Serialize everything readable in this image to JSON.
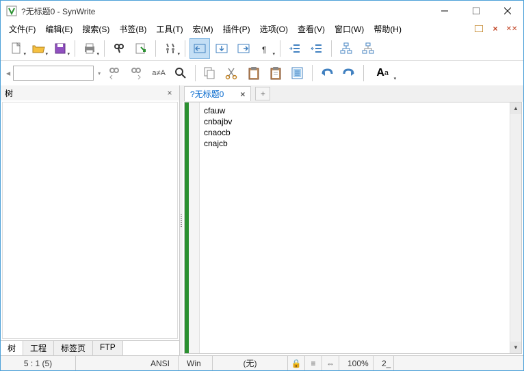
{
  "window": {
    "title": "?无标题0 - SynWrite"
  },
  "menu": {
    "items": [
      "文件(F)",
      "编辑(E)",
      "搜索(S)",
      "书签(B)",
      "工具(T)",
      "宏(M)",
      "插件(P)",
      "选项(O)",
      "查看(V)",
      "窗口(W)",
      "帮助(H)"
    ]
  },
  "left": {
    "title": "树",
    "tabs": [
      "树",
      "工程",
      "标签页",
      "FTP"
    ]
  },
  "doc": {
    "tab_label": "?无标题0",
    "lines": [
      "cfauw",
      "cnbajbv",
      "cnaocb",
      "cnajcb"
    ]
  },
  "status": {
    "pos": "5 : 1 (5)",
    "enc": "ANSI",
    "le": "Win",
    "lex": "(无)",
    "zoom": "100%",
    "sp": "2_"
  }
}
